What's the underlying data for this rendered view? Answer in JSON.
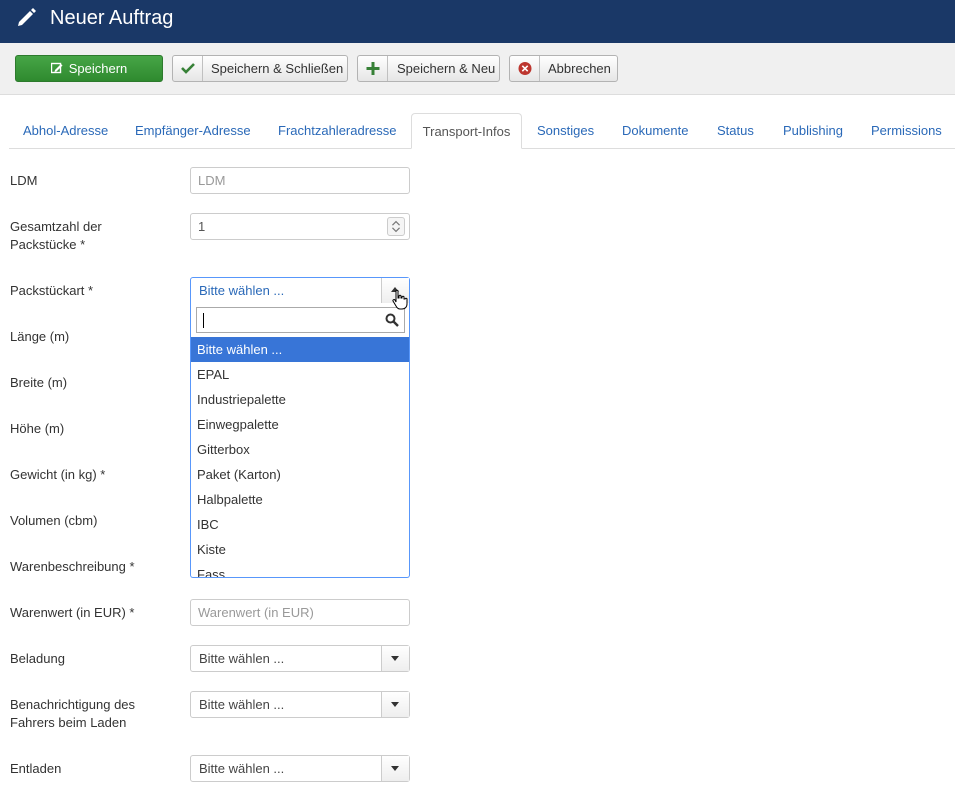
{
  "header": {
    "title": "Neuer Auftrag",
    "icon": "pencil-icon"
  },
  "toolbar": {
    "save": "Speichern",
    "save_close": "Speichern & Schließen",
    "save_new": "Speichern & Neu",
    "cancel": "Abbrechen"
  },
  "tabs": [
    {
      "label": "Abhol-Adresse"
    },
    {
      "label": "Empfänger-Adresse"
    },
    {
      "label": "Frachtzahleradresse"
    },
    {
      "label": "Transport-Infos",
      "active": true
    },
    {
      "label": "Sonstiges"
    },
    {
      "label": "Dokumente"
    },
    {
      "label": "Status"
    },
    {
      "label": "Publishing"
    },
    {
      "label": "Permissions"
    }
  ],
  "form": {
    "ldm": {
      "label": "LDM",
      "placeholder": "LDM"
    },
    "gesamtzahl": {
      "label_line1": "Gesamtzahl der",
      "label_line2": "Packstücke *",
      "value": "1"
    },
    "packstueckart": {
      "label": "Packstückart *",
      "value": "Bitte wählen ..."
    },
    "laenge": {
      "label": "Länge (m)"
    },
    "breite": {
      "label": "Breite (m)"
    },
    "hoehe": {
      "label": "Höhe (m)"
    },
    "gewicht": {
      "label": "Gewicht (in kg) *"
    },
    "volumen": {
      "label": "Volumen (cbm)"
    },
    "warenbeschreibung": {
      "label": "Warenbeschreibung *"
    },
    "warenwert": {
      "label": "Warenwert (in EUR) *",
      "placeholder": "Warenwert (in EUR)"
    },
    "beladung": {
      "label": "Beladung",
      "value": "Bitte wählen ..."
    },
    "benachrichtigung": {
      "label_line1": "Benachrichtigung des",
      "label_line2": "Fahrers beim Laden",
      "value": "Bitte wählen ..."
    },
    "entladen": {
      "label": "Entladen",
      "value": "Bitte wählen ..."
    }
  },
  "dropdown": {
    "search_value": "",
    "options": [
      "Bitte wählen ...",
      "EPAL",
      "Industriepalette",
      "Einwegpalette",
      "Gitterbox",
      "Paket (Karton)",
      "Halbpalette",
      "IBC",
      "Kiste",
      "Fass"
    ],
    "highlighted_index": 0
  },
  "colors": {
    "header_bg": "#1a3867",
    "save_green": "#46a546",
    "link_blue": "#2a69b8",
    "highlight_blue": "#3875d7"
  }
}
